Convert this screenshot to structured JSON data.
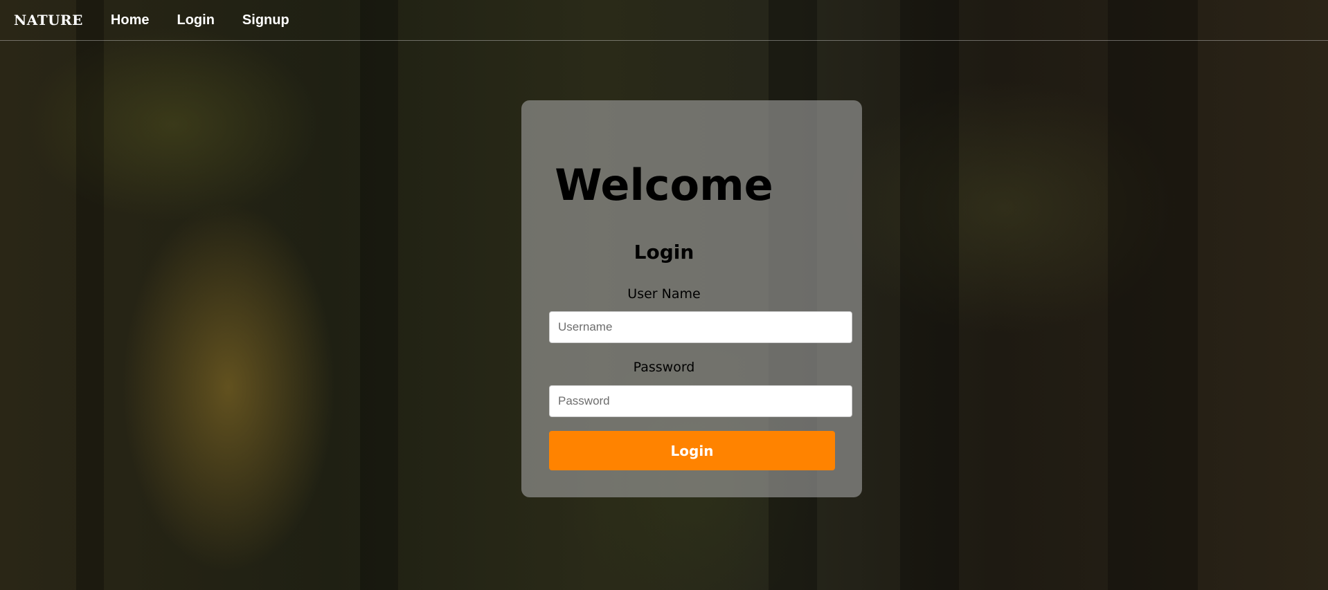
{
  "nav": {
    "brand": "NATURE",
    "links": [
      "Home",
      "Login",
      "Signup"
    ]
  },
  "card": {
    "title": "Welcome",
    "subtitle": "Login",
    "username_label": "User Name",
    "username_placeholder": "Username",
    "username_value": "",
    "password_label": "Password",
    "password_placeholder": "Password",
    "password_value": "",
    "submit_label": "Login"
  },
  "colors": {
    "accent": "#ff8300",
    "card_background": "rgba(160,160,160,0.62)"
  }
}
